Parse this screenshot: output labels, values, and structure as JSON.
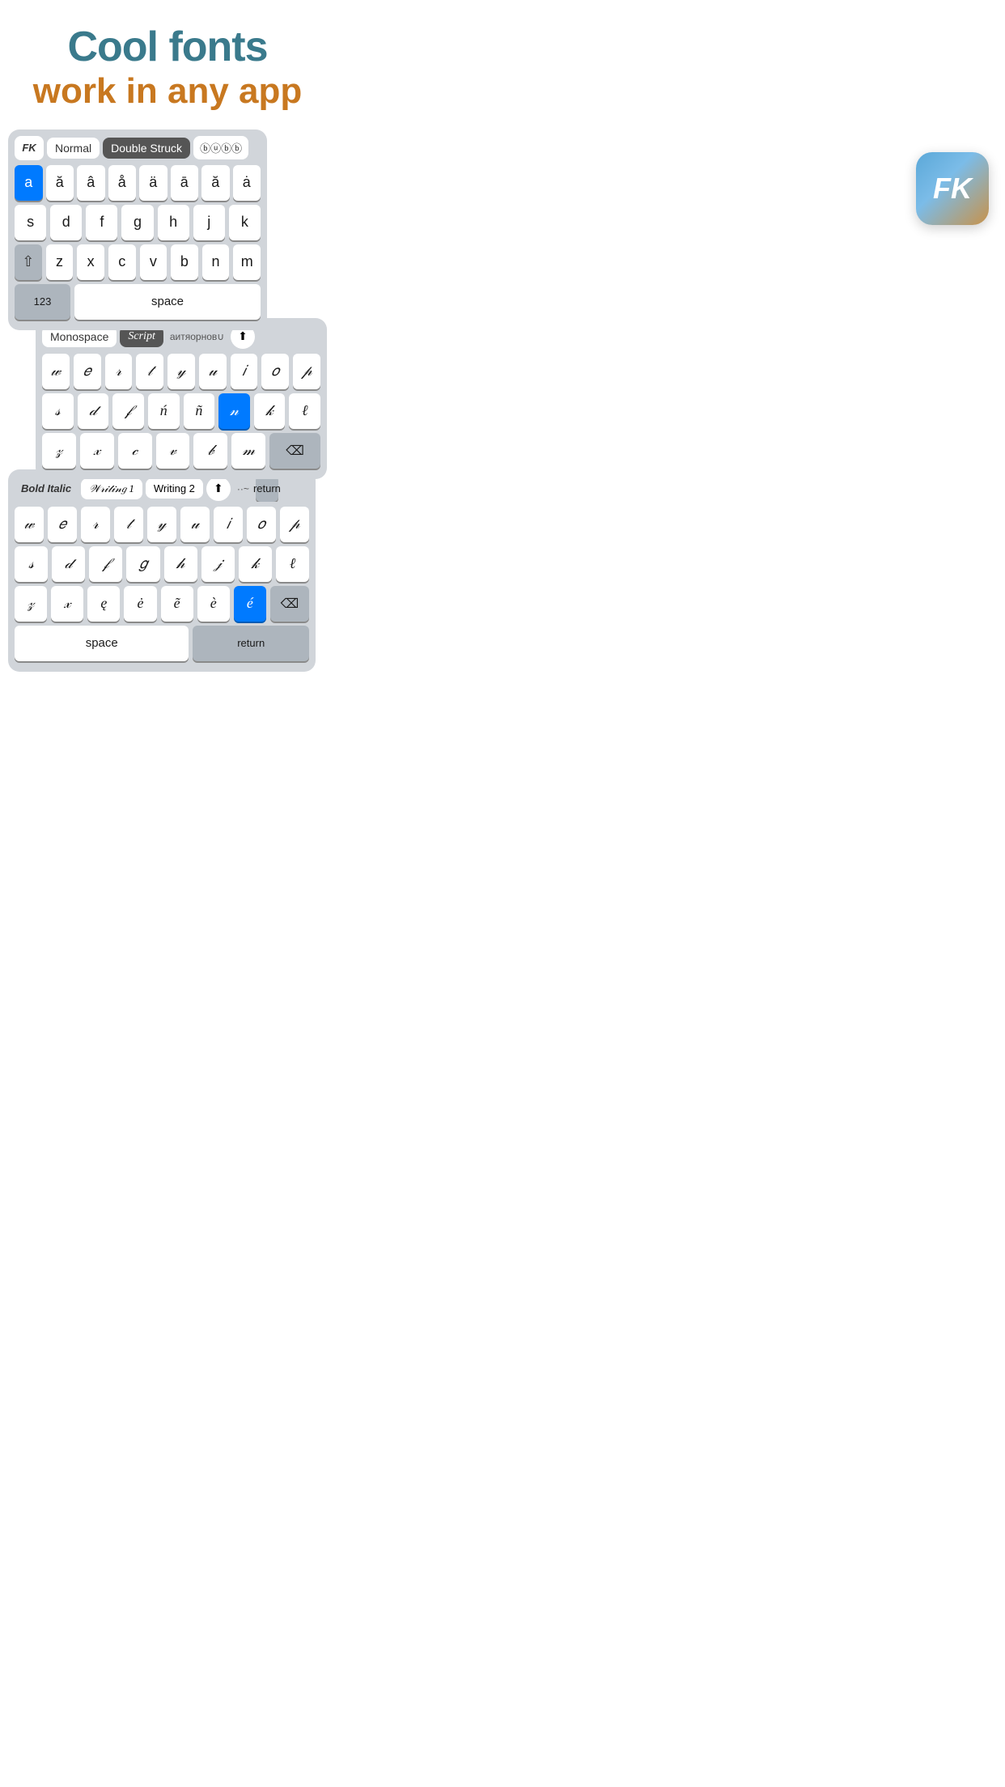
{
  "header": {
    "line1": "Cool fonts",
    "line2": "work in any app"
  },
  "app_icon": {
    "text": "FK",
    "aria": "Font Keyboard app icon"
  },
  "keyboard1": {
    "tabs": [
      "FK",
      "Normal",
      "Double Struck",
      "Bubb"
    ],
    "accent_row": [
      "a",
      "ă",
      "â",
      "å",
      "ä",
      "ā",
      "ă",
      "ȧ"
    ],
    "rows": [
      [
        "s",
        "d",
        "f",
        "g",
        "h",
        "j",
        "k"
      ],
      [
        "z",
        "x",
        "c",
        "v",
        "b",
        "n",
        "m"
      ]
    ],
    "bottom": [
      "123",
      "space"
    ]
  },
  "keyboard2": {
    "tabs": [
      "Monospace",
      "Script",
      "аитяopнов∪",
      "share"
    ],
    "rows": [
      [
        "w",
        "e",
        "r",
        "t",
        "y",
        "u",
        "i",
        "o",
        "p"
      ],
      [
        "s",
        "d",
        "ƒ",
        "ń",
        "ñ",
        "n",
        "k",
        "ℓ"
      ],
      [
        "z",
        "x",
        "c",
        "v",
        "b",
        "m"
      ]
    ]
  },
  "keyboard3": {
    "tabs": [
      "Bold Italic",
      "Writing 1",
      "Writing 2",
      "share",
      "··~",
      "return"
    ],
    "rows": [
      [
        "w",
        "e",
        "r",
        "t",
        "y",
        "u",
        "i",
        "o",
        "p"
      ],
      [
        "s",
        "d",
        "ƒ",
        "g",
        "h",
        "j",
        "k",
        "ℓ"
      ],
      [
        "z",
        "x",
        "ę",
        "ė",
        "ẽ",
        "è",
        "é"
      ]
    ],
    "bottom": [
      "space",
      "return"
    ]
  }
}
